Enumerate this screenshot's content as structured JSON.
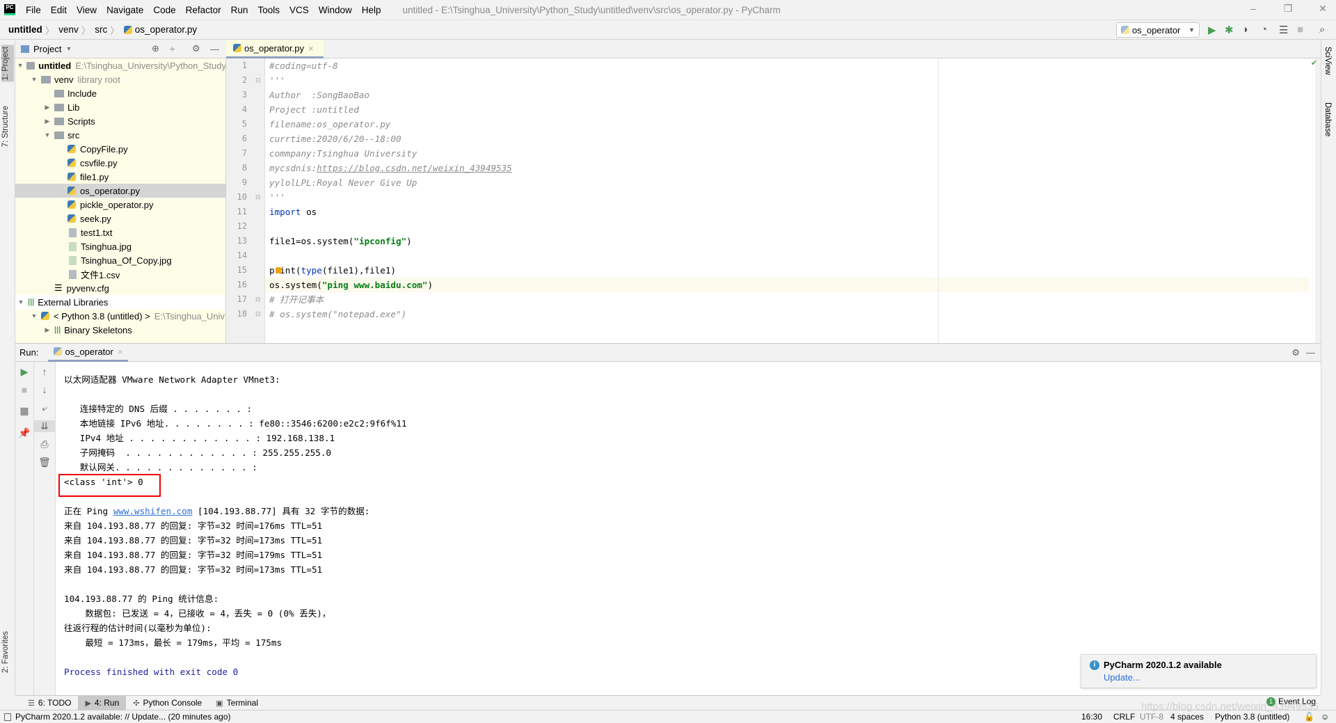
{
  "menubar": {
    "items": [
      "File",
      "Edit",
      "View",
      "Navigate",
      "Code",
      "Refactor",
      "Run",
      "Tools",
      "VCS",
      "Window",
      "Help"
    ],
    "window_title": "untitled - E:\\Tsinghua_University\\Python_Study\\untitled\\venv\\src\\os_operator.py - PyCharm"
  },
  "breadcrumb": [
    "untitled",
    "venv",
    "src",
    "os_operator.py"
  ],
  "toolbar": {
    "run_config": "os_operator"
  },
  "left_stripe": {
    "project": "1: Project",
    "structure": "7: Structure",
    "favorites": "2: Favorites"
  },
  "right_stripe": {
    "sciview": "SciView",
    "database": "Database"
  },
  "project": {
    "title": "Project",
    "tree": [
      {
        "label": "untitled",
        "hint": "E:\\Tsinghua_University\\Python_Study",
        "level": 0,
        "arrow": "down",
        "icon": "folder",
        "bold": true
      },
      {
        "label": "venv",
        "hint": "library root",
        "level": 1,
        "arrow": "down",
        "icon": "folder"
      },
      {
        "label": "Include",
        "level": 2,
        "icon": "folder"
      },
      {
        "label": "Lib",
        "level": 2,
        "arrow": "right",
        "icon": "folder"
      },
      {
        "label": "Scripts",
        "level": 2,
        "arrow": "right",
        "icon": "folder"
      },
      {
        "label": "src",
        "level": 2,
        "arrow": "down",
        "icon": "folder"
      },
      {
        "label": "CopyFile.py",
        "level": 3,
        "icon": "python"
      },
      {
        "label": "csvfile.py",
        "level": 3,
        "icon": "python"
      },
      {
        "label": "file1.py",
        "level": 3,
        "icon": "python"
      },
      {
        "label": "os_operator.py",
        "level": 3,
        "icon": "python",
        "selected": true
      },
      {
        "label": "pickle_operator.py",
        "level": 3,
        "icon": "python"
      },
      {
        "label": "seek.py",
        "level": 3,
        "icon": "python"
      },
      {
        "label": "test1.txt",
        "level": 3,
        "icon": "text"
      },
      {
        "label": "Tsinghua.jpg",
        "level": 3,
        "icon": "image"
      },
      {
        "label": "Tsinghua_Of_Copy.jpg",
        "level": 3,
        "icon": "image"
      },
      {
        "label": "文件1.csv",
        "level": 3,
        "icon": "text"
      },
      {
        "label": "pyvenv.cfg",
        "level": 2,
        "icon": "config"
      },
      {
        "label": "External Libraries",
        "level": 0,
        "arrow": "down",
        "icon": "library",
        "plain": true
      },
      {
        "label": "< Python 3.8 (untitled) >",
        "hint": "E:\\Tsinghua_Univ",
        "level": 1,
        "arrow": "down",
        "icon": "python"
      },
      {
        "label": "Binary Skeletons",
        "level": 2,
        "arrow": "right",
        "icon": "library"
      }
    ]
  },
  "editor": {
    "tab": "os_operator.py",
    "current_line": 16,
    "lines": [
      [
        {
          "t": "#coding=utf-8",
          "c": "cmt"
        }
      ],
      [
        {
          "t": "'''",
          "c": "cmt"
        }
      ],
      [
        {
          "t": "Author  :SongBaoBao",
          "c": "cmt"
        }
      ],
      [
        {
          "t": "Project :untitled",
          "c": "cmt"
        }
      ],
      [
        {
          "t": "filename:os_operator.py",
          "c": "cmt"
        }
      ],
      [
        {
          "t": "currtime:2020/6/20--18:00",
          "c": "cmt"
        }
      ],
      [
        {
          "t": "commpany:Tsinghua University",
          "c": "cmt"
        }
      ],
      [
        {
          "t": "mycsdnis:",
          "c": "cmt"
        },
        {
          "t": "https://blog.csdn.net/weixin_43949535",
          "c": "cmt link-u"
        }
      ],
      [
        {
          "t": "yylolLPL:Royal Never Give Up",
          "c": "cmt"
        }
      ],
      [
        {
          "t": "'''",
          "c": "cmt"
        }
      ],
      [
        {
          "t": "import",
          "c": "kw"
        },
        {
          "t": " os",
          "c": ""
        }
      ],
      [],
      [
        {
          "t": "file1=os.system(",
          "c": ""
        },
        {
          "t": "\"ipconfig\"",
          "c": "str"
        },
        {
          "t": ")",
          "c": ""
        }
      ],
      [],
      [
        {
          "t": "print(",
          "c": ""
        },
        {
          "t": "type",
          "c": "kw"
        },
        {
          "t": "(file1),file1)",
          "c": ""
        }
      ],
      [
        {
          "t": "os.system(",
          "c": ""
        },
        {
          "t": "\"ping www.baidu.com\"",
          "c": "str"
        },
        {
          "t": ")",
          "c": ""
        }
      ],
      [
        {
          "t": "# 打开记事本",
          "c": "cmt"
        }
      ],
      [
        {
          "t": "# os.system(\"notepad.exe\")",
          "c": "cmt"
        }
      ]
    ]
  },
  "run": {
    "label": "Run:",
    "tab": "os_operator",
    "console": [
      {
        "t": "以太网适配器 VMware Network Adapter VMnet3:"
      },
      {
        "t": ""
      },
      {
        "t": "   连接特定的 DNS 后缀 . . . . . . . :"
      },
      {
        "t": "   本地链接 IPv6 地址. . . . . . . . : fe80::3546:6200:e2c2:9f6f%11"
      },
      {
        "t": "   IPv4 地址 . . . . . . . . . . . . : 192.168.138.1"
      },
      {
        "t": "   子网掩码  . . . . . . . . . . . . : 255.255.255.0"
      },
      {
        "t": "   默认网关. . . . . . . . . . . . . :"
      },
      {
        "t": "<class 'int'> 0"
      },
      {
        "t": ""
      },
      {
        "pre": "正在 Ping ",
        "link": "www.wshifen.com",
        "post": " [104.193.88.77] 具有 32 字节的数据:"
      },
      {
        "t": "来自 104.193.88.77 的回复: 字节=32 时间=176ms TTL=51"
      },
      {
        "t": "来自 104.193.88.77 的回复: 字节=32 时间=173ms TTL=51"
      },
      {
        "t": "来自 104.193.88.77 的回复: 字节=32 时间=179ms TTL=51"
      },
      {
        "t": "来自 104.193.88.77 的回复: 字节=32 时间=173ms TTL=51"
      },
      {
        "t": ""
      },
      {
        "t": "104.193.88.77 的 Ping 统计信息:"
      },
      {
        "t": "    数据包: 已发送 = 4，已接收 = 4，丢失 = 0 (0% 丢失)，"
      },
      {
        "t": "往返行程的估计时间(以毫秒为单位):"
      },
      {
        "t": "    最短 = 173ms，最长 = 179ms，平均 = 175ms"
      },
      {
        "t": ""
      },
      {
        "t": "Process finished with exit code 0",
        "fin": true
      }
    ]
  },
  "notification": {
    "title": "PyCharm 2020.1.2 available",
    "action": "Update..."
  },
  "bottom_tabs": [
    {
      "label": "6: TODO",
      "icon": "list"
    },
    {
      "label": "4: Run",
      "icon": "play",
      "active": true
    },
    {
      "label": "Python Console",
      "icon": "python"
    },
    {
      "label": "Terminal",
      "icon": "terminal"
    }
  ],
  "event_log": {
    "label": "Event Log",
    "count": "1"
  },
  "status": {
    "message": "PyCharm 2020.1.2 available: // Update... (20 minutes ago)",
    "position": "16:30",
    "line_sep": "CRLF",
    "encoding": "UTF-8",
    "indent": "4 spaces",
    "interpreter": "Python 3.8 (untitled)"
  },
  "watermark": "https://blog.csdn.net/weixin_43949535",
  "colors": {
    "highlight_box": "#e00000",
    "project_bg": "#fefde8",
    "run_green": "#499c54",
    "link": "#2a6fd6"
  }
}
